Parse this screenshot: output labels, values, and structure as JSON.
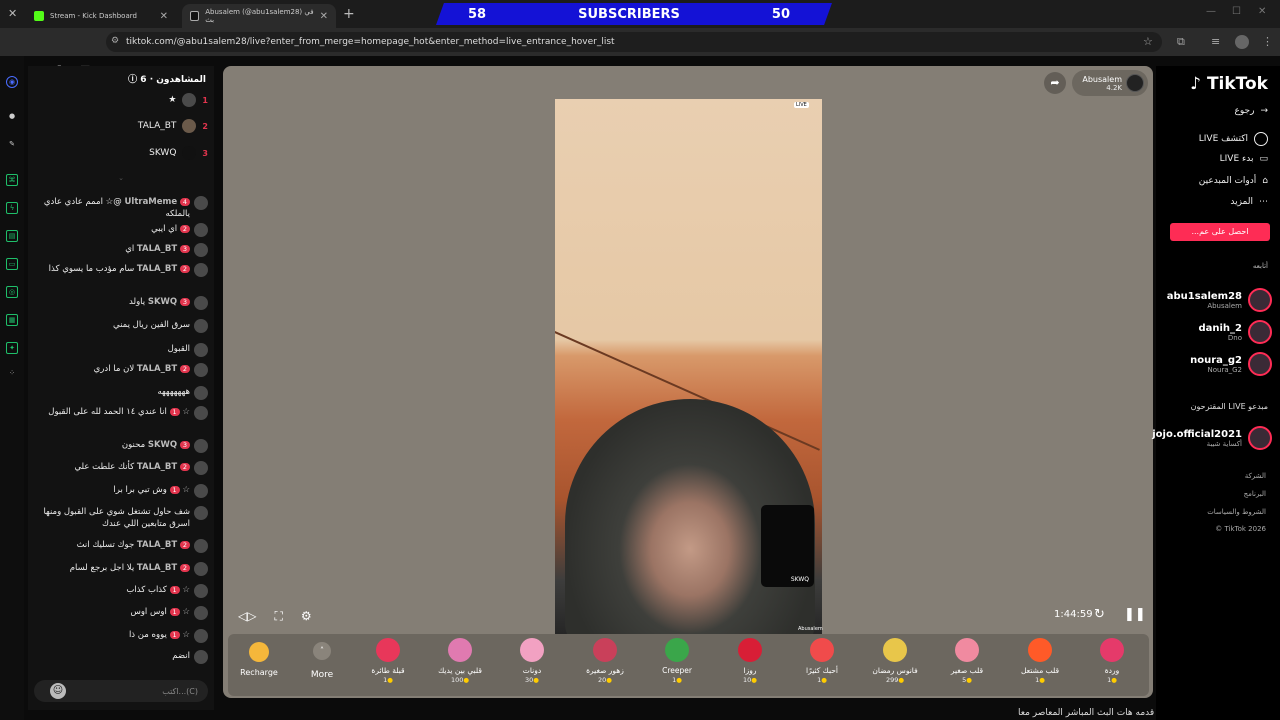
{
  "browser": {
    "tabs": [
      {
        "title": "Stream - Kick Dashboard",
        "active": false
      },
      {
        "title": "Abusalem (@abu1salem28) في بث",
        "active": true
      }
    ],
    "url": "tiktok.com/@abu1salem28/live?enter_from_merge=homepage_hot&enter_method=live_entrance_hover_list"
  },
  "overlay": {
    "left_count": "58",
    "label": "SUBSCRIBERS",
    "right_count": "50"
  },
  "chat": {
    "viewers_title": "المشاهدون · 6",
    "top": [
      {
        "rank": "1",
        "name": "★"
      },
      {
        "rank": "2",
        "name": "TALA_BT"
      },
      {
        "rank": "3",
        "name": "SKWQ"
      }
    ],
    "messages": [
      {
        "user": "UltraMeme",
        "badge": "4",
        "text": "@☆ اممم عادي عادي يالملكه"
      },
      {
        "user": "",
        "badge": "2",
        "text": "اي ايبي"
      },
      {
        "user": "TALA_BT",
        "badge": "3",
        "text": "اي"
      },
      {
        "user": "TALA_BT",
        "badge": "2",
        "text": "سام مؤدب ما يسوي كذا"
      },
      {
        "user": "SKWQ",
        "badge": "3",
        "text": "ياولد"
      },
      {
        "user": "",
        "badge": "",
        "text": "سرق الفين ريال يمني"
      },
      {
        "user": "",
        "badge": "",
        "text": "القبول"
      },
      {
        "user": "TALA_BT",
        "badge": "2",
        "text": "لان ما ادري"
      },
      {
        "user": "",
        "badge": "",
        "text": "هههههههه"
      },
      {
        "user": "☆",
        "badge": "1",
        "text": "انا عندي ١٤ الحمد لله على القبول"
      },
      {
        "user": "SKWQ",
        "badge": "3",
        "text": "محنون"
      },
      {
        "user": "TALA_BT",
        "badge": "2",
        "text": "كأنك علطت علي"
      },
      {
        "user": "☆",
        "badge": "1",
        "text": "وش تبي برا برا"
      },
      {
        "user": "",
        "badge": "",
        "text": "شف حاول تشتغل شوي على القبول ومنها اسرق متابعين اللي عندك"
      },
      {
        "user": "TALA_BT",
        "badge": "2",
        "text": "جوك تسليك انث"
      },
      {
        "user": "TALA_BT",
        "badge": "2",
        "text": "يلا اجل برجع لسام"
      },
      {
        "user": "☆",
        "badge": "1",
        "text": "كذاب كذاب"
      },
      {
        "user": "☆",
        "badge": "1",
        "text": "اوس اوس"
      },
      {
        "user": "☆",
        "badge": "1",
        "text": "يووه من ذا"
      },
      {
        "user": "",
        "badge": "",
        "text": "انضم"
      }
    ],
    "input_placeholder": "اكتب...(C)"
  },
  "stream": {
    "host_name": "Abusalem",
    "host_likes": "4.2K",
    "pip_label": "SKWQ",
    "watermark": "Abusalem",
    "time": "1:44:59",
    "live_badge": "LIVE"
  },
  "gifts": {
    "recharge": "Recharge",
    "more": "More",
    "items": [
      {
        "name": "قبلة طائرة",
        "price": "1",
        "color": "#e8375a"
      },
      {
        "name": "قلبي بين يديك",
        "price": "100",
        "color": "#e07ab0"
      },
      {
        "name": "دونات",
        "price": "30",
        "color": "#f2a1c2"
      },
      {
        "name": "زهور صغيرة",
        "price": "20",
        "color": "#c9405a"
      },
      {
        "name": "Creeper",
        "price": "1",
        "color": "#3aa64a"
      },
      {
        "name": "روزا",
        "price": "10",
        "color": "#d81e36"
      },
      {
        "name": "أحبك كثيرًا",
        "price": "1",
        "color": "#f04b4b"
      },
      {
        "name": "فانوس رمضان",
        "price": "299",
        "color": "#e8c64a"
      },
      {
        "name": "قلب صغير",
        "price": "5",
        "color": "#f08aa0"
      },
      {
        "name": "قلب مشتعل",
        "price": "1",
        "color": "#ff5a28"
      },
      {
        "name": "وردة",
        "price": "1",
        "color": "#e53a6a"
      }
    ]
  },
  "caption": "قدمه هات البث المباشر المعاصر معا",
  "sidebar": {
    "logo": "TikTok",
    "nav": [
      {
        "label": "رجوع",
        "icon": "back-arrow-icon"
      },
      {
        "label": "اكتشف LIVE",
        "icon": "live-discover-icon"
      },
      {
        "label": "بدء LIVE",
        "icon": "camera-icon"
      },
      {
        "label": "أدوات المبدعين",
        "icon": "tools-icon"
      },
      {
        "label": "المزيد",
        "icon": "more-dots-icon"
      }
    ],
    "get_button": "احصل على عم...",
    "following_title": "أتابعه",
    "following": [
      {
        "name": "abu1salem28",
        "sub": "Abusalem"
      },
      {
        "name": "danih_2",
        "sub": "Dno"
      },
      {
        "name": "noura_g2",
        "sub": "Noura_G2"
      }
    ],
    "suggested_title": "مبدعو LIVE المقترحون",
    "suggested": [
      {
        "name": "jojo.official2021",
        "sub": "أكساية شيبة"
      }
    ],
    "footer": [
      "الشركة",
      "البرنامج",
      "الشروط والسياسات",
      "TikTok 2026 ©"
    ]
  }
}
